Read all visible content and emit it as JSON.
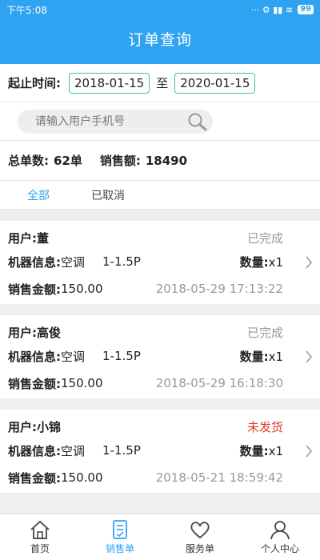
{
  "statusbar": {
    "time": "下午5:08",
    "battery": "99",
    "icons_text": "··· ⚙ ▮▮ ≋"
  },
  "header": {
    "title": "订单查询"
  },
  "filter": {
    "date_label": "起止时间:",
    "start_date": "2018-01-15",
    "separator": "至",
    "end_date": "2020-01-15",
    "search_placeholder": "请输入用户手机号"
  },
  "summary": {
    "total_orders_label": "总单数:",
    "total_orders_value": "62单",
    "sales_label": "销售额:",
    "sales_value": "18490"
  },
  "tabs": [
    {
      "label": "全部"
    },
    {
      "label": "已取消"
    }
  ],
  "orders": [
    {
      "user_label": "用户:",
      "user": "董",
      "status": "已完成",
      "machine_label": "机器信息:",
      "machine": "空调",
      "model": "1-1.5P",
      "qty_label": "数量:",
      "qty": "x1",
      "amount_label": "销售金额:",
      "amount": "150.00",
      "time": "2018-05-29 17:13:22"
    },
    {
      "user_label": "用户:",
      "user": "高俊",
      "status": "已完成",
      "machine_label": "机器信息:",
      "machine": "空调",
      "model": "1-1.5P",
      "qty_label": "数量:",
      "qty": "x1",
      "amount_label": "销售金额:",
      "amount": "150.00",
      "time": "2018-05-29 16:18:30"
    },
    {
      "user_label": "用户:",
      "user": "小锦",
      "status": "未发货",
      "machine_label": "机器信息:",
      "machine": "空调",
      "model": "1-1.5P",
      "qty_label": "数量:",
      "qty": "x1",
      "amount_label": "销售金额:",
      "amount": "150.00",
      "time": "2018-05-21 18:59:42"
    }
  ],
  "bottom_nav": [
    {
      "label": "首页",
      "icon": "home-icon"
    },
    {
      "label": "销售单",
      "icon": "sales-order-icon"
    },
    {
      "label": "服务单",
      "icon": "heart-icon"
    },
    {
      "label": "个人中心",
      "icon": "user-icon"
    }
  ],
  "colors": {
    "primary": "#2ea3f2",
    "accent_border": "#3cbfae",
    "pending": "#e23a2e"
  }
}
